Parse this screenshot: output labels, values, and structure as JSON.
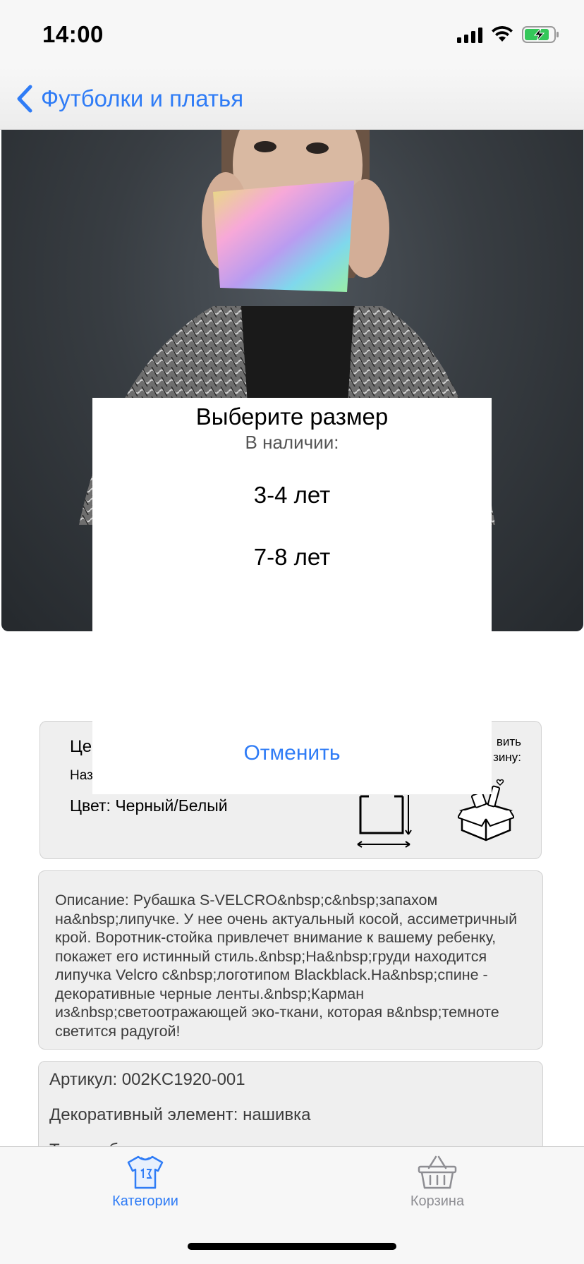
{
  "status_bar": {
    "time": "14:00"
  },
  "nav": {
    "back_label": "Футболки и платья"
  },
  "product": {
    "price_label": "Це",
    "name_label": "Наз",
    "color_label": "Цвет: Черный/Белый",
    "add_to_cart_line1": "вить",
    "add_to_cart_line2": "зину:",
    "description": "Описание: Рубашка S-VELCRO&nbsp;с&nbsp;запахом на&nbsp;липучке. У нее очень актуальный косой, ассиметричный крой. Воротник-стойка привлечет внимание к вашему ребенку, покажет его истинный стиль.&nbsp;На&nbsp;груди находится липучка Velcro с&nbsp;логотипом Blackblack.На&nbsp;спине - декоративные черные ленты.&nbsp;Карман из&nbsp;светоотражающей эко-ткани, которая в&nbsp;темноте светится радугой!",
    "details": [
      "Артикул: 002KC1920-001",
      "Декоративный элемент: нашивка",
      "Тип изображения: геометрия"
    ]
  },
  "size_picker": {
    "title": "Выберите размер",
    "subtitle": "В наличии:",
    "options": [
      "3-4 лет",
      "7-8 лет"
    ],
    "cancel_label": "Отменить"
  },
  "tabs": [
    {
      "label": "Категории",
      "icon": "tshirt-icon",
      "active": true
    },
    {
      "label": "Корзина",
      "icon": "basket-icon",
      "active": false
    }
  ],
  "colors": {
    "accent": "#2f7cf6",
    "inactive": "#8e8e93",
    "battery": "#34c759"
  }
}
